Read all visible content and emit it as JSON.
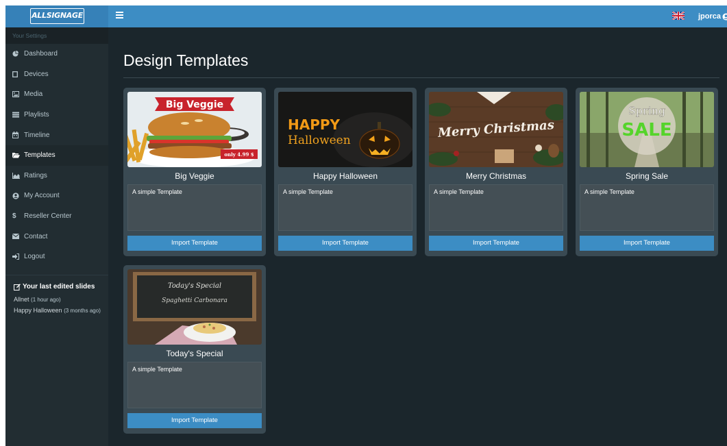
{
  "brand": {
    "logo_text": "ALLSIGNAGE",
    "accent": "#3c8dc4",
    "topbar_color": "#3d8dc4",
    "sidebar_color": "#222d32",
    "content_background": "#1b262c"
  },
  "topbar": {
    "menu_icon": "hamburger-icon",
    "language_flag_icon": "uk-flag-icon",
    "username": "jporca",
    "user_icon": "user-circle-icon"
  },
  "sidebar": {
    "header": "Your Settings",
    "items": [
      {
        "label": "Dashboard",
        "icon": "pie-chart-icon",
        "active": false
      },
      {
        "label": "Devices",
        "icon": "square-outline-icon",
        "active": false
      },
      {
        "label": "Media",
        "icon": "image-icon",
        "active": false
      },
      {
        "label": "Playlists",
        "icon": "list-icon",
        "active": false
      },
      {
        "label": "Timeline",
        "icon": "calendar-icon",
        "active": false
      },
      {
        "label": "Templates",
        "icon": "folder-open-icon",
        "active": true
      },
      {
        "label": "Ratings",
        "icon": "area-chart-icon",
        "active": false
      },
      {
        "label": "My Account",
        "icon": "user-circle-icon",
        "active": false
      },
      {
        "label": "Reseller Center",
        "icon": "dollar-icon",
        "active": false
      },
      {
        "label": "Contact",
        "icon": "envelope-icon",
        "active": false
      },
      {
        "label": "Logout",
        "icon": "sign-out-icon",
        "active": false
      }
    ],
    "last_edited": {
      "title": "Your last edited slides",
      "icon": "edit-icon",
      "items": [
        {
          "name": "Allnet",
          "ago": "(1 hour ago)"
        },
        {
          "name": "Happy Halloween",
          "ago": "(3 months ago)"
        }
      ]
    }
  },
  "main": {
    "title": "Design Templates",
    "templates": [
      {
        "name": "Big Veggie",
        "description": "A simple Template",
        "button": "Import Template",
        "image_banner": "Big Veggie",
        "image_price": "only 4.99 $"
      },
      {
        "name": "Happy Halloween",
        "description": "A simple Template",
        "button": "Import Template",
        "image_line1": "HAPPY",
        "image_line2": "Halloween"
      },
      {
        "name": "Merry Christmas",
        "description": "A simple Template",
        "button": "Import Template",
        "image_text": "Merry Christmas"
      },
      {
        "name": "Spring Sale",
        "description": "A simple Template",
        "button": "Import Template",
        "image_line1": "Spring",
        "image_line2": "SALE"
      },
      {
        "name": "Today's Special",
        "description": "A simple Template",
        "button": "Import Template",
        "image_line1": "Today's Special",
        "image_line2": "Spaghetti Carbonara"
      }
    ]
  }
}
